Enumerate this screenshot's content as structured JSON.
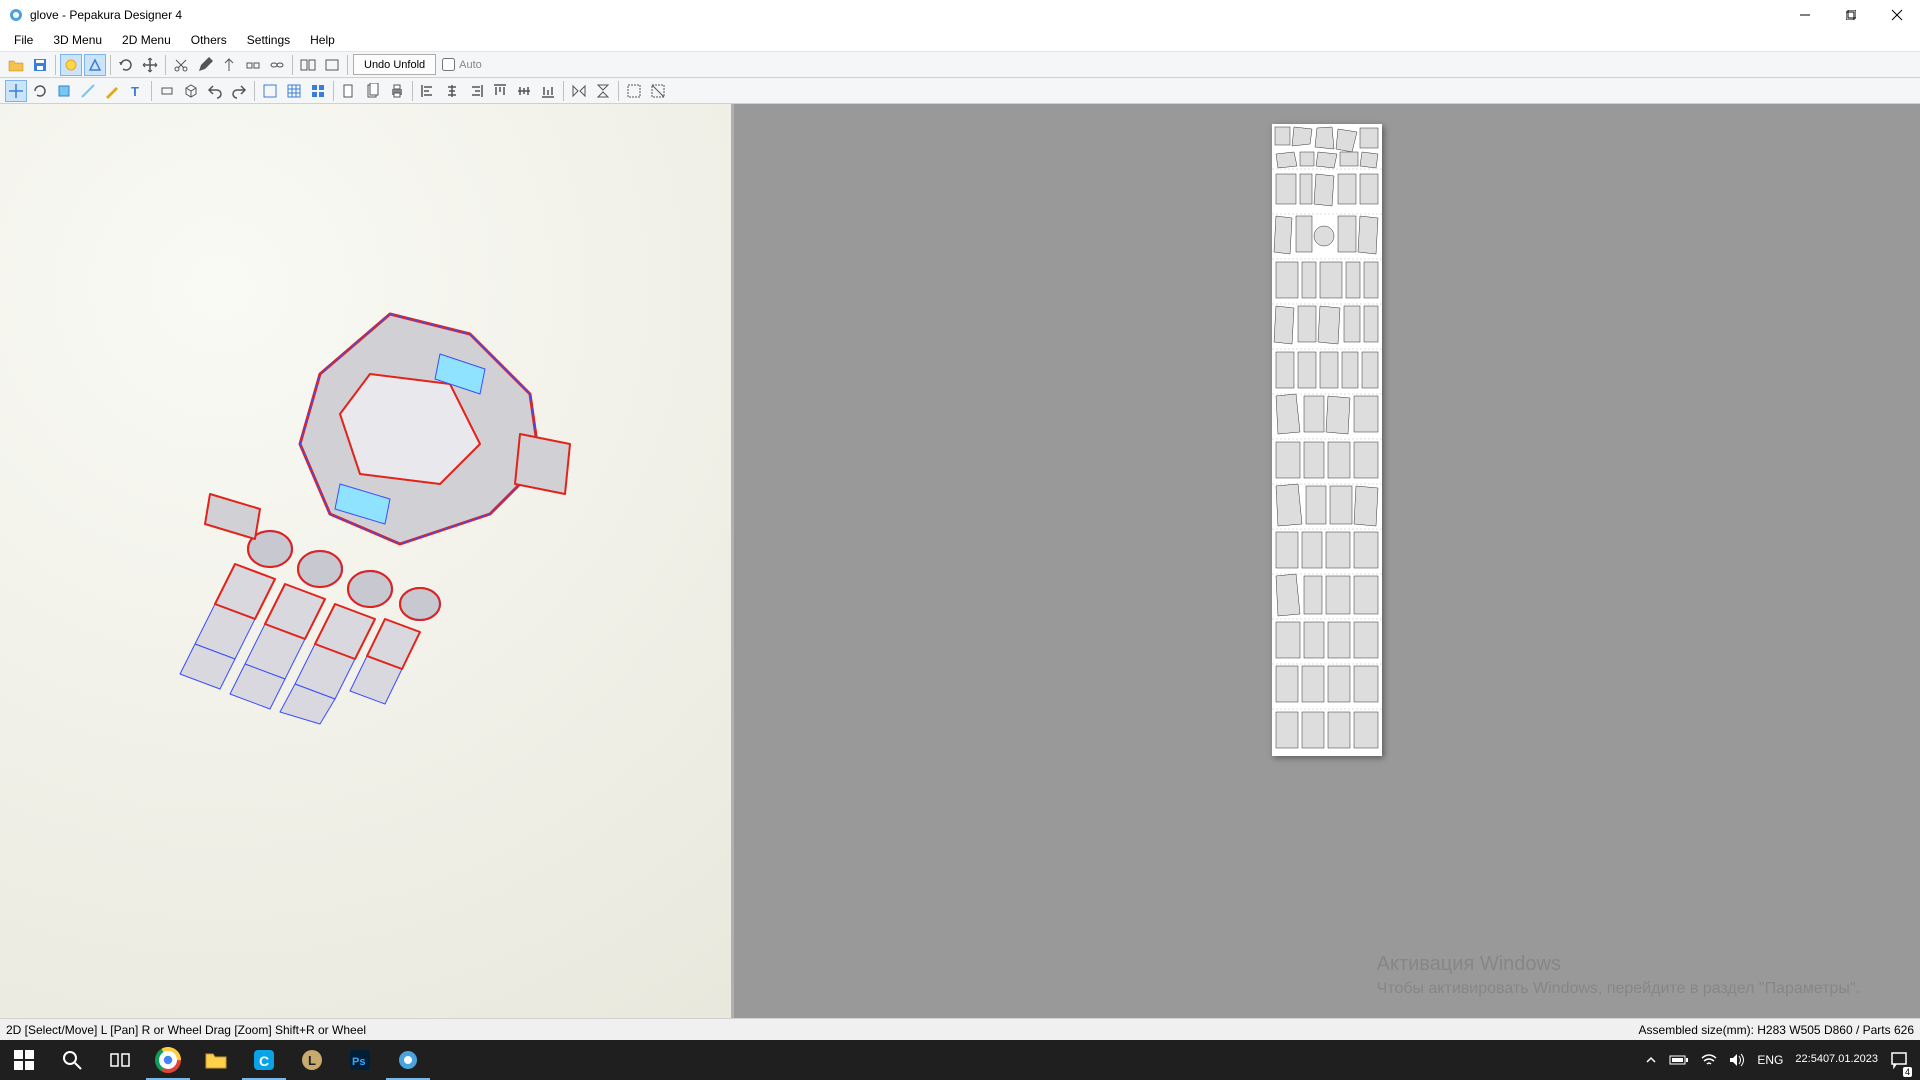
{
  "titlebar": {
    "title": "glove - Pepakura Designer 4"
  },
  "menu": {
    "file": "File",
    "menu3d": "3D Menu",
    "menu2d": "2D Menu",
    "others": "Others",
    "settings": "Settings",
    "help": "Help"
  },
  "toolbar1": {
    "undo_unfold": "Undo Unfold",
    "auto": "Auto",
    "auto_checked": false
  },
  "statusbar": {
    "left": "2D [Select/Move] L [Pan] R or Wheel Drag [Zoom] Shift+R or Wheel",
    "right": "Assembled size(mm): H283 W505 D860 / Parts 626"
  },
  "watermark": {
    "title": "Активация Windows",
    "subtitle": "Чтобы активировать Windows, перейдите в раздел \"Параметры\"."
  },
  "taskbar": {
    "lang": "ENG",
    "time": "22:54",
    "date": "07.01.2023",
    "notif_count": "4"
  }
}
